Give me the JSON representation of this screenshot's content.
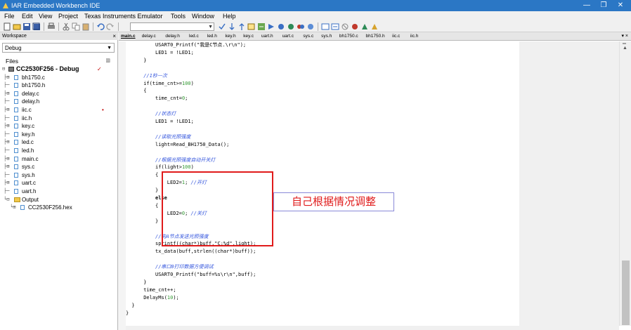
{
  "window": {
    "title": "IAR Embedded Workbench IDE",
    "minimize_glyph": "—",
    "restore_glyph": "❐",
    "close_glyph": "✕"
  },
  "menu": [
    "File",
    "Edit",
    "View",
    "Project",
    "Texas Instruments Emulator",
    "Tools",
    "Window",
    "Help"
  ],
  "workspace": {
    "header": "Workspace",
    "close_glyph": "×",
    "config": "Debug",
    "files_label": "Files",
    "tree": [
      {
        "name": "CC2530F256 - Debug",
        "kind": "project",
        "level": 0,
        "connector": "⊟",
        "mark": "✓"
      },
      {
        "name": "bh1750.c",
        "kind": "file",
        "level": 1,
        "connector": "├⊞"
      },
      {
        "name": "bh1750.h",
        "kind": "file",
        "level": 1,
        "connector": "├─"
      },
      {
        "name": "delay.c",
        "kind": "file",
        "level": 1,
        "connector": "├⊞"
      },
      {
        "name": "delay.h",
        "kind": "file",
        "level": 1,
        "connector": "├─"
      },
      {
        "name": "iic.c",
        "kind": "file",
        "level": 1,
        "connector": "├⊞",
        "mark": "•"
      },
      {
        "name": "iic.h",
        "kind": "file",
        "level": 1,
        "connector": "├─"
      },
      {
        "name": "key.c",
        "kind": "file",
        "level": 1,
        "connector": "├⊞"
      },
      {
        "name": "key.h",
        "kind": "file",
        "level": 1,
        "connector": "├─"
      },
      {
        "name": "led.c",
        "kind": "file",
        "level": 1,
        "connector": "├⊞"
      },
      {
        "name": "led.h",
        "kind": "file",
        "level": 1,
        "connector": "├─"
      },
      {
        "name": "main.c",
        "kind": "file",
        "level": 1,
        "connector": "├⊞"
      },
      {
        "name": "sys.c",
        "kind": "file",
        "level": 1,
        "connector": "├⊞"
      },
      {
        "name": "sys.h",
        "kind": "file",
        "level": 1,
        "connector": "├─"
      },
      {
        "name": "uart.c",
        "kind": "file",
        "level": 1,
        "connector": "├⊞"
      },
      {
        "name": "uart.h",
        "kind": "file",
        "level": 1,
        "connector": "├─"
      },
      {
        "name": "Output",
        "kind": "folder",
        "level": 1,
        "connector": "└⊟"
      },
      {
        "name": "CC2530F256.hex",
        "kind": "file",
        "level": 2,
        "connector": "└⊞"
      }
    ]
  },
  "editor": {
    "tabs": [
      "main.c",
      "delay.c",
      "delay.h",
      "led.c",
      "led.h",
      "key.h",
      "key.c",
      "uart.h",
      "uart.c",
      "sys.c",
      "sys.h",
      "bh1750.c",
      "bh1750.h",
      "iic.c",
      "iic.h"
    ],
    "active_tab": "main.c",
    "pin_glyph": "▾ ×",
    "lines": [
      {
        "indent": 5,
        "parts": [
          {
            "t": "USART0_Printf(\"我是C节点.\\r\\n\");",
            "k": "code"
          }
        ]
      },
      {
        "indent": 5,
        "parts": [
          {
            "t": "LED1 = !LED1;",
            "k": "code"
          }
        ]
      },
      {
        "indent": 3,
        "parts": [
          {
            "t": "}",
            "k": "code"
          }
        ]
      },
      {
        "indent": 0,
        "parts": [
          {
            "t": "",
            "k": "code"
          }
        ]
      },
      {
        "indent": 3,
        "parts": [
          {
            "t": "//1秒一次",
            "k": "cmt"
          }
        ]
      },
      {
        "indent": 3,
        "parts": [
          {
            "t": "if",
            "k": "code"
          },
          {
            "t": "(time_cnt>=",
            "k": "code"
          },
          {
            "t": "100",
            "k": "num"
          },
          {
            "t": ")",
            "k": "code"
          }
        ]
      },
      {
        "indent": 3,
        "parts": [
          {
            "t": "{",
            "k": "code"
          }
        ]
      },
      {
        "indent": 5,
        "parts": [
          {
            "t": "time_cnt=",
            "k": "code"
          },
          {
            "t": "0",
            "k": "num"
          },
          {
            "t": ";",
            "k": "code"
          }
        ]
      },
      {
        "indent": 0,
        "parts": [
          {
            "t": "",
            "k": "code"
          }
        ]
      },
      {
        "indent": 5,
        "parts": [
          {
            "t": "//状态灯",
            "k": "cmt"
          }
        ]
      },
      {
        "indent": 5,
        "parts": [
          {
            "t": "LED1 = !LED1;",
            "k": "code"
          }
        ]
      },
      {
        "indent": 0,
        "parts": [
          {
            "t": "",
            "k": "code"
          }
        ]
      },
      {
        "indent": 5,
        "parts": [
          {
            "t": "//读取光照强度",
            "k": "cmt"
          }
        ]
      },
      {
        "indent": 5,
        "parts": [
          {
            "t": "light=Read_BH1750_Data();",
            "k": "code"
          }
        ]
      },
      {
        "indent": 0,
        "parts": [
          {
            "t": "",
            "k": "code"
          }
        ]
      },
      {
        "indent": 5,
        "parts": [
          {
            "t": "//根据光照强度自动开关灯",
            "k": "cmt"
          }
        ]
      },
      {
        "indent": 5,
        "parts": [
          {
            "t": "if",
            "k": "code"
          },
          {
            "t": "(light>",
            "k": "code"
          },
          {
            "t": "100",
            "k": "num"
          },
          {
            "t": ")",
            "k": "code"
          }
        ]
      },
      {
        "indent": 5,
        "parts": [
          {
            "t": "{",
            "k": "code"
          }
        ]
      },
      {
        "indent": 7,
        "parts": [
          {
            "t": "LED2=",
            "k": "code"
          },
          {
            "t": "1",
            "k": "num"
          },
          {
            "t": "; ",
            "k": "code"
          },
          {
            "t": "//开灯",
            "k": "cmt"
          }
        ]
      },
      {
        "indent": 5,
        "parts": [
          {
            "t": "}",
            "k": "code"
          }
        ]
      },
      {
        "indent": 5,
        "parts": [
          {
            "t": "else",
            "k": "kw"
          }
        ]
      },
      {
        "indent": 5,
        "parts": [
          {
            "t": "{",
            "k": "code"
          }
        ]
      },
      {
        "indent": 7,
        "parts": [
          {
            "t": "LED2=",
            "k": "code"
          },
          {
            "t": "0",
            "k": "num"
          },
          {
            "t": "; ",
            "k": "code"
          },
          {
            "t": "//关灯",
            "k": "cmt"
          }
        ]
      },
      {
        "indent": 5,
        "parts": [
          {
            "t": "}",
            "k": "code"
          }
        ]
      },
      {
        "indent": 0,
        "parts": [
          {
            "t": "",
            "k": "code"
          }
        ]
      },
      {
        "indent": 5,
        "parts": [
          {
            "t": "//向A节点发送光照强度",
            "k": "cmt"
          }
        ]
      },
      {
        "indent": 5,
        "parts": [
          {
            "t": "sprintf((char*)buff,\"C:%d\",light);",
            "k": "code"
          }
        ]
      },
      {
        "indent": 5,
        "parts": [
          {
            "t": "tx_data(buff,strlen((char*)buff));",
            "k": "code"
          }
        ]
      },
      {
        "indent": 0,
        "parts": [
          {
            "t": "",
            "k": "code"
          }
        ]
      },
      {
        "indent": 5,
        "parts": [
          {
            "t": "//串口0打印数据方便调试",
            "k": "cmt"
          }
        ]
      },
      {
        "indent": 5,
        "parts": [
          {
            "t": "USART0_Printf(\"buff=%s\\r\\n\",buff);",
            "k": "code"
          }
        ]
      },
      {
        "indent": 3,
        "parts": [
          {
            "t": "}",
            "k": "code"
          }
        ]
      },
      {
        "indent": 3,
        "parts": [
          {
            "t": "time_cnt++;",
            "k": "code"
          }
        ]
      },
      {
        "indent": 3,
        "parts": [
          {
            "t": "DelayMs(",
            "k": "code"
          },
          {
            "t": "10",
            "k": "num"
          },
          {
            "t": ");",
            "k": "code"
          }
        ]
      },
      {
        "indent": 1,
        "parts": [
          {
            "t": "}",
            "k": "code"
          }
        ]
      },
      {
        "indent": 0,
        "parts": [
          {
            "t": "}",
            "k": "code"
          }
        ]
      }
    ]
  },
  "annotation": {
    "text": "自己根据情况调整",
    "border_color": "#e01b1b",
    "text_color": "#e01b1b"
  },
  "colors": {
    "titlebar": "#2b77c5",
    "comment": "#3355dd",
    "number": "#339933"
  }
}
